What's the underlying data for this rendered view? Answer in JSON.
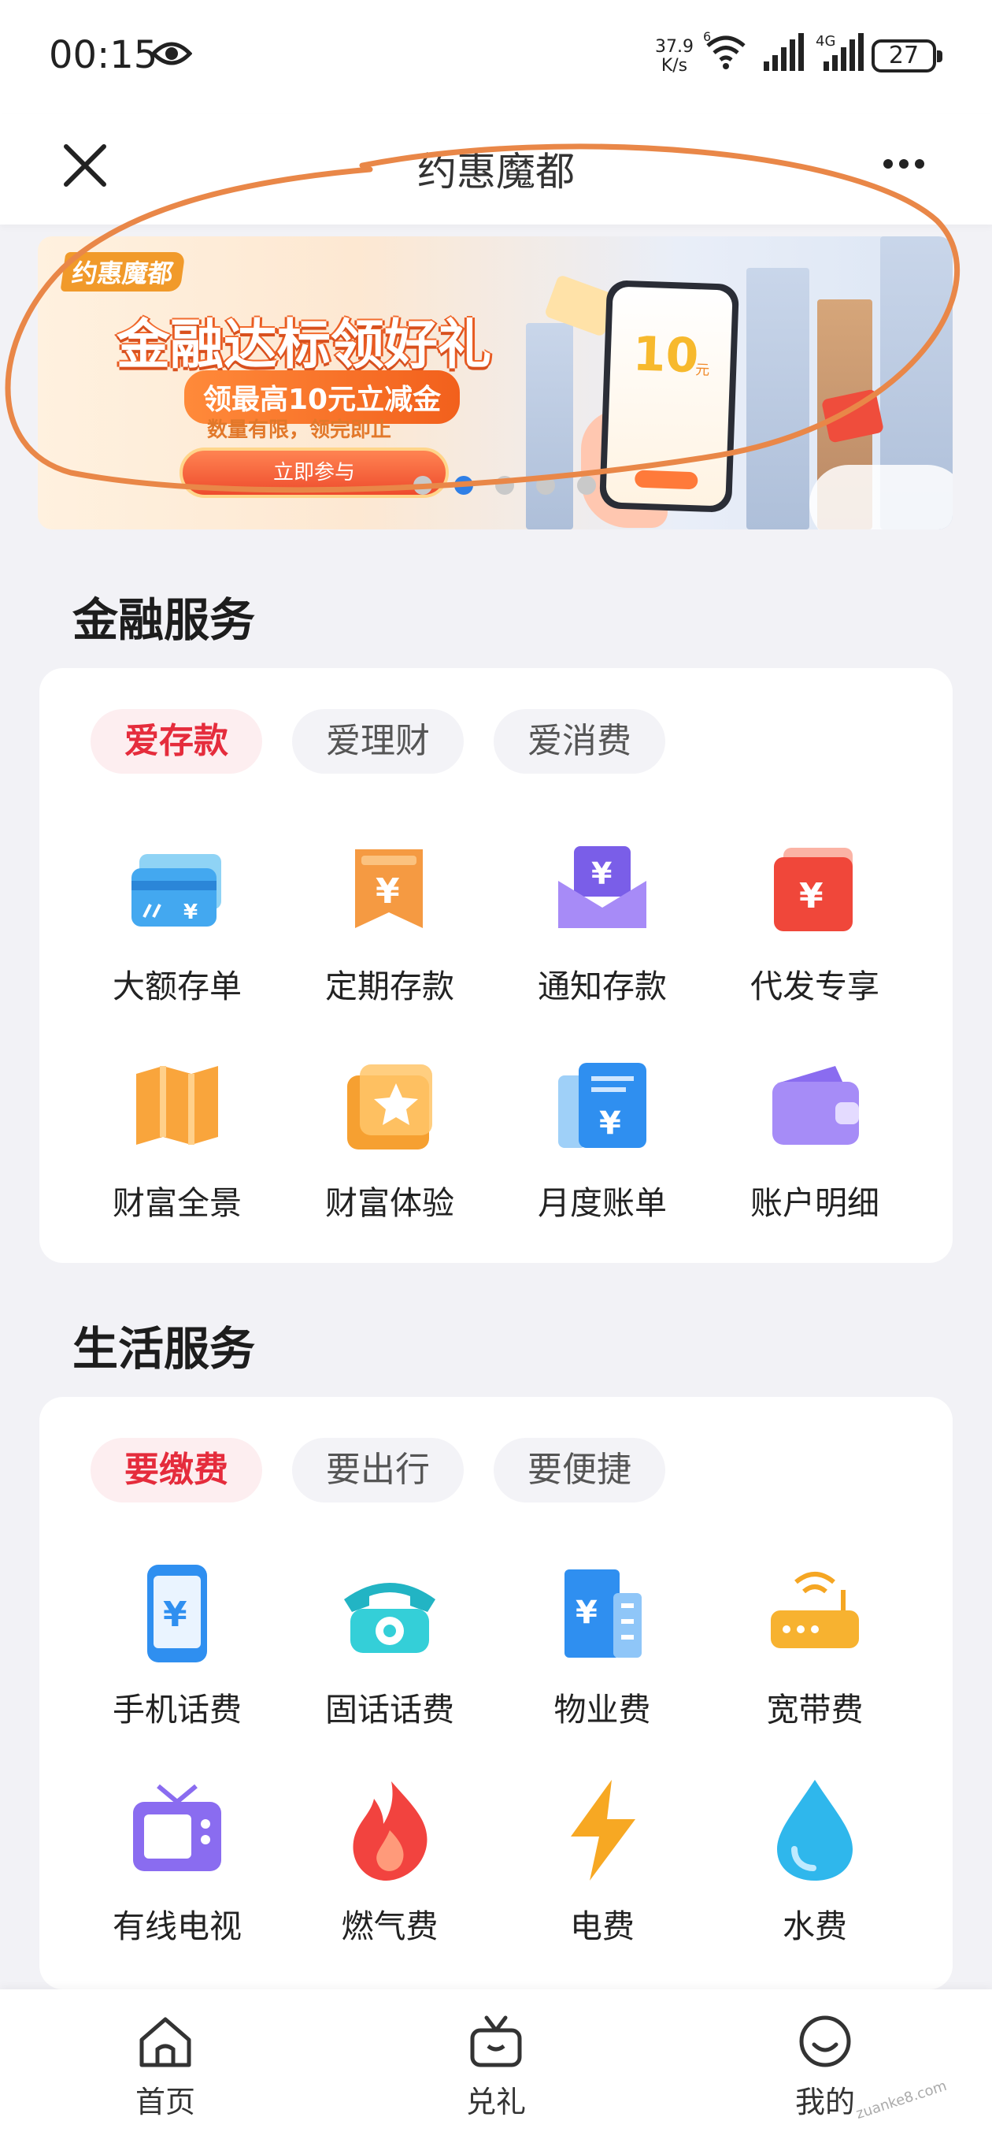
{
  "status_bar": {
    "time": "00:15",
    "speed_value": "37.9",
    "speed_unit": "K/s",
    "network": "4G",
    "wifi_label": "6",
    "battery": "27"
  },
  "nav": {
    "title": "约惠魔都"
  },
  "banner": {
    "logo": "约惠魔都",
    "title": "金融达标领好礼",
    "subtitle": "领最高10元立减金",
    "note": "数量有限，领完即止",
    "button_label": "立即参与",
    "phone_value": "10",
    "phone_unit": "元",
    "slide_count": 5,
    "active_slide": 2
  },
  "finance": {
    "title": "金融服务",
    "tabs": [
      "爱存款",
      "爱理财",
      "爱消费"
    ],
    "active_tab": 0,
    "items": [
      {
        "label": "大额存单",
        "icon": "card-icon"
      },
      {
        "label": "定期存款",
        "icon": "yuan-bookmark-icon"
      },
      {
        "label": "通知存款",
        "icon": "yuan-envelope-icon"
      },
      {
        "label": "代发专享",
        "icon": "yuan-wallet-icon"
      },
      {
        "label": "财富全景",
        "icon": "map-icon"
      },
      {
        "label": "财富体验",
        "icon": "star-card-icon"
      },
      {
        "label": "月度账单",
        "icon": "yuan-bill-icon"
      },
      {
        "label": "账户明细",
        "icon": "wallet-icon"
      }
    ]
  },
  "life": {
    "title": "生活服务",
    "tabs": [
      "要缴费",
      "要出行",
      "要便捷"
    ],
    "active_tab": 0,
    "items": [
      {
        "label": "手机话费",
        "icon": "phone-yuan-icon"
      },
      {
        "label": "固话话费",
        "icon": "telephone-icon"
      },
      {
        "label": "物业费",
        "icon": "building-icon"
      },
      {
        "label": "宽带费",
        "icon": "router-icon"
      },
      {
        "label": "有线电视",
        "icon": "tv-icon"
      },
      {
        "label": "燃气费",
        "icon": "flame-icon"
      },
      {
        "label": "电费",
        "icon": "lightning-icon"
      },
      {
        "label": "水费",
        "icon": "water-drop-icon"
      }
    ]
  },
  "bottom_nav": [
    {
      "label": "首页",
      "icon": "home-icon"
    },
    {
      "label": "兑礼",
      "icon": "gift-icon"
    },
    {
      "label": "我的",
      "icon": "smile-icon"
    }
  ],
  "watermark": "zuanke8.com"
}
